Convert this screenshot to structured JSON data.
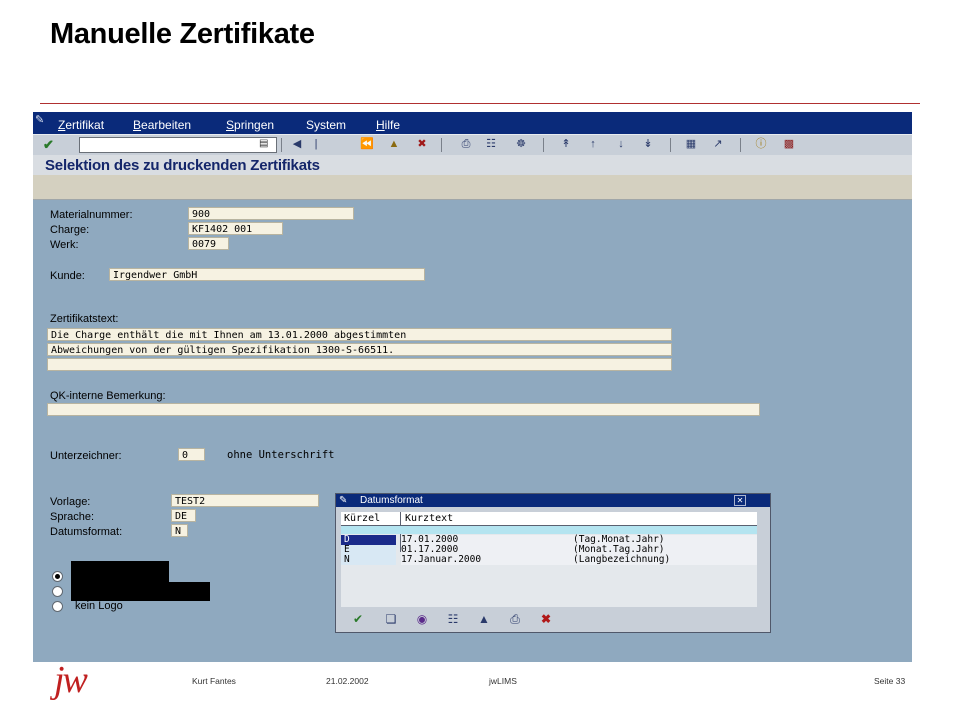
{
  "slide": {
    "title": "Manuelle Zertifikate"
  },
  "menu": {
    "items": [
      {
        "accel": "Z",
        "rest": "ertifikat"
      },
      {
        "accel": "B",
        "rest": "earbeiten"
      },
      {
        "accel": "S",
        "rest": "pringen"
      },
      {
        "accel": "",
        "rest": "System"
      },
      {
        "accel": "H",
        "rest": "ilfe"
      }
    ]
  },
  "screen": {
    "title": "Selektion des zu druckenden Zertifikats"
  },
  "form": {
    "material_label": "Materialnummer:",
    "material_value": "900",
    "charge_label": "Charge:",
    "charge_value": "KF1402_001",
    "werk_label": "Werk:",
    "werk_value": "0079",
    "kunde_label": "Kunde:",
    "kunde_value": "Irgendwer GmbH",
    "zertifikatstext_label": "Zertifikatstext:",
    "zertifikatstext_lines": [
      "Die Charge enthält die mit Ihnen am 13.01.2000 abgestimmten",
      "Abweichungen von der gültigen Spezifikation 1300-S-66511.",
      ""
    ],
    "bemerkung_label": "QK-interne Bemerkung:",
    "bemerkung_value": "",
    "unterzeichner_label": "Unterzeichner:",
    "unterzeichner_value": "0",
    "unterzeichner_text": "ohne Unterschrift",
    "vorlage_label": "Vorlage:",
    "vorlage_value": "TEST2",
    "sprache_label": "Sprache:",
    "sprache_value": "DE",
    "datumsformat_label": "Datumsformat:",
    "datumsformat_value": "N",
    "logo_options": {
      "selected": 0,
      "third_label": "kein Logo"
    }
  },
  "popup": {
    "title": "Datumsformat",
    "col_key": "Kürzel",
    "col_text": "Kurztext",
    "rows": [
      {
        "key": "D",
        "sample": "17.01.2000",
        "format": "(Tag.Monat.Jahr)",
        "selected": true
      },
      {
        "key": "E",
        "sample": "01.17.2000",
        "format": "(Monat.Tag.Jahr)",
        "selected": false
      },
      {
        "key": "N",
        "sample": "17.Januar.2000",
        "format": "(Langbezeichnung)",
        "selected": false
      }
    ]
  },
  "footer": {
    "logo": "jw",
    "author": "Kurt Fantes",
    "date": "21.02.2002",
    "product": "jwLIMS",
    "page": "Seite 33"
  },
  "colors": {
    "sap_background": "#8fa9bf",
    "menubar": "#0a2a7a",
    "title_rule": "#b03030",
    "logo_red": "#c02020"
  }
}
